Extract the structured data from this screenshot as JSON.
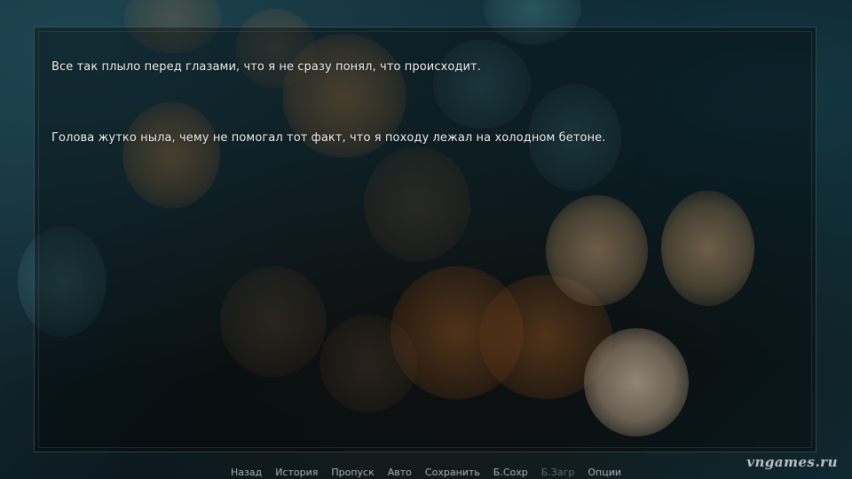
{
  "dialogue": {
    "lines": [
      "Все так плыло перед глазами, что я не сразу понял, что происходит.",
      "Голова жутко ныла, чему не помогал тот факт, что я походу лежал на холодном бетоне."
    ]
  },
  "quick_menu": {
    "items": [
      {
        "label": "Назад",
        "enabled": true
      },
      {
        "label": "История",
        "enabled": true
      },
      {
        "label": "Пропуск",
        "enabled": true
      },
      {
        "label": "Авто",
        "enabled": true
      },
      {
        "label": "Сохранить",
        "enabled": true
      },
      {
        "label": "Б.Сохр",
        "enabled": true
      },
      {
        "label": "Б.Загр",
        "enabled": false
      },
      {
        "label": "Опции",
        "enabled": true
      }
    ]
  },
  "watermark": "vngames.ru",
  "colors": {
    "text": "#f2f2f2",
    "menu_text": "#a9b3b6",
    "menu_disabled": "#5c6a6e",
    "window_border": "#789696"
  },
  "background": {
    "description_icon": "bokeh-lights-icon"
  }
}
